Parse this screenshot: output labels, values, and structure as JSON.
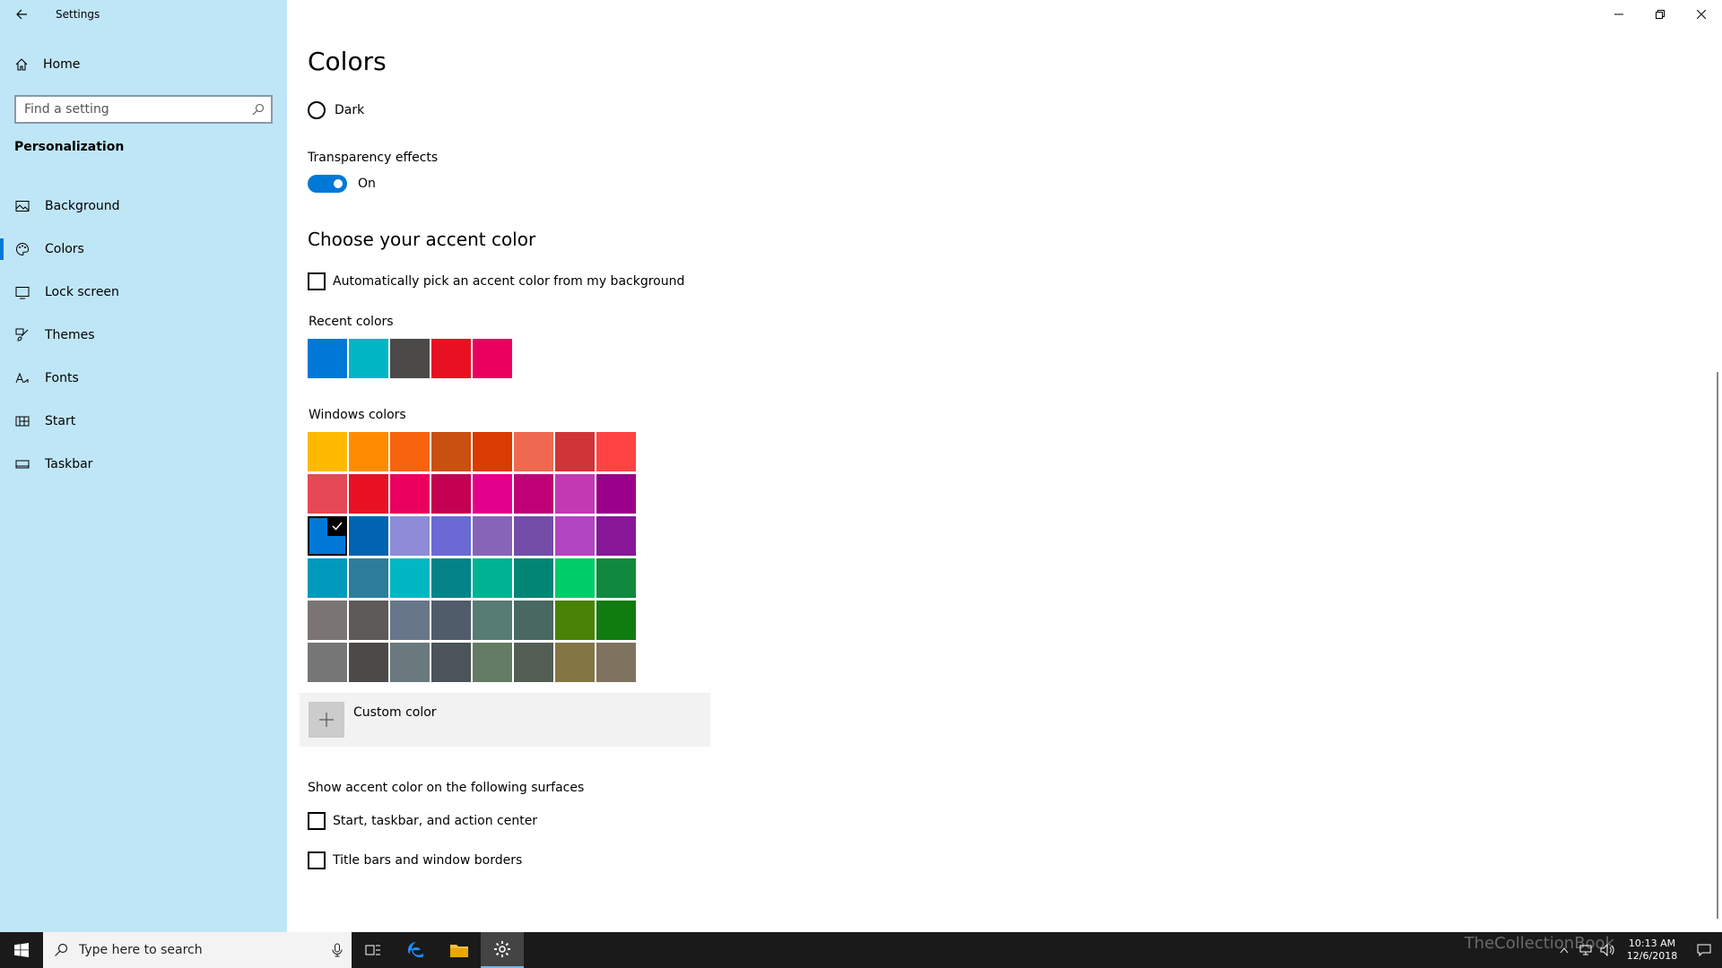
{
  "window": {
    "title": "Settings"
  },
  "sidebar": {
    "home_label": "Home",
    "search_placeholder": "Find a setting",
    "section": "Personalization",
    "items": [
      {
        "label": "Background",
        "icon": "image-icon"
      },
      {
        "label": "Colors",
        "icon": "palette-icon"
      },
      {
        "label": "Lock screen",
        "icon": "lock-screen-icon"
      },
      {
        "label": "Themes",
        "icon": "brush-icon"
      },
      {
        "label": "Fonts",
        "icon": "font-icon"
      },
      {
        "label": "Start",
        "icon": "start-icon"
      },
      {
        "label": "Taskbar",
        "icon": "taskbar-icon"
      }
    ]
  },
  "main": {
    "title": "Colors",
    "mode_option": "Dark",
    "transparency": {
      "label": "Transparency effects",
      "state": "On"
    },
    "accent_title": "Choose your accent color",
    "auto_pick_label": "Automatically pick an accent color from my background",
    "recent_label": "Recent colors",
    "recent_colors": [
      "#0078d7",
      "#00b7c3",
      "#4c4a48",
      "#e81123",
      "#ea005e"
    ],
    "windows_colors_label": "Windows colors",
    "windows_colors": [
      [
        "#ffb900",
        "#ff8c00",
        "#f7630c",
        "#ca5010",
        "#da3b01",
        "#ef6950",
        "#d13438",
        "#ff4343"
      ],
      [
        "#e74856",
        "#e81123",
        "#ea005e",
        "#c30052",
        "#e3008c",
        "#bf0077",
        "#c239b3",
        "#9a0089"
      ],
      [
        "#0078d7",
        "#0063b1",
        "#8e8cd8",
        "#6b69d6",
        "#8764b8",
        "#744da9",
        "#b146c2",
        "#881798"
      ],
      [
        "#0099bc",
        "#2d7d9a",
        "#00b7c3",
        "#038387",
        "#00b294",
        "#018574",
        "#00cc6a",
        "#10893e"
      ],
      [
        "#7a7574",
        "#5d5a58",
        "#68768a",
        "#515c6b",
        "#567c73",
        "#486860",
        "#498205",
        "#107c10"
      ],
      [
        "#767676",
        "#4c4a48",
        "#69797e",
        "#4a5459",
        "#647c64",
        "#525e54",
        "#847545",
        "#7e735f"
      ]
    ],
    "selected_color": "#0078d7",
    "custom_color_label": "Custom color",
    "surfaces_label": "Show accent color on the following surfaces",
    "surface_start_label": "Start, taskbar, and action center",
    "surface_title_label": "Title bars and window borders"
  },
  "taskbar": {
    "search_text": "Type here to search",
    "time": "10:13 AM",
    "date": "12/6/2018",
    "watermark": "TheCollectionBook"
  }
}
